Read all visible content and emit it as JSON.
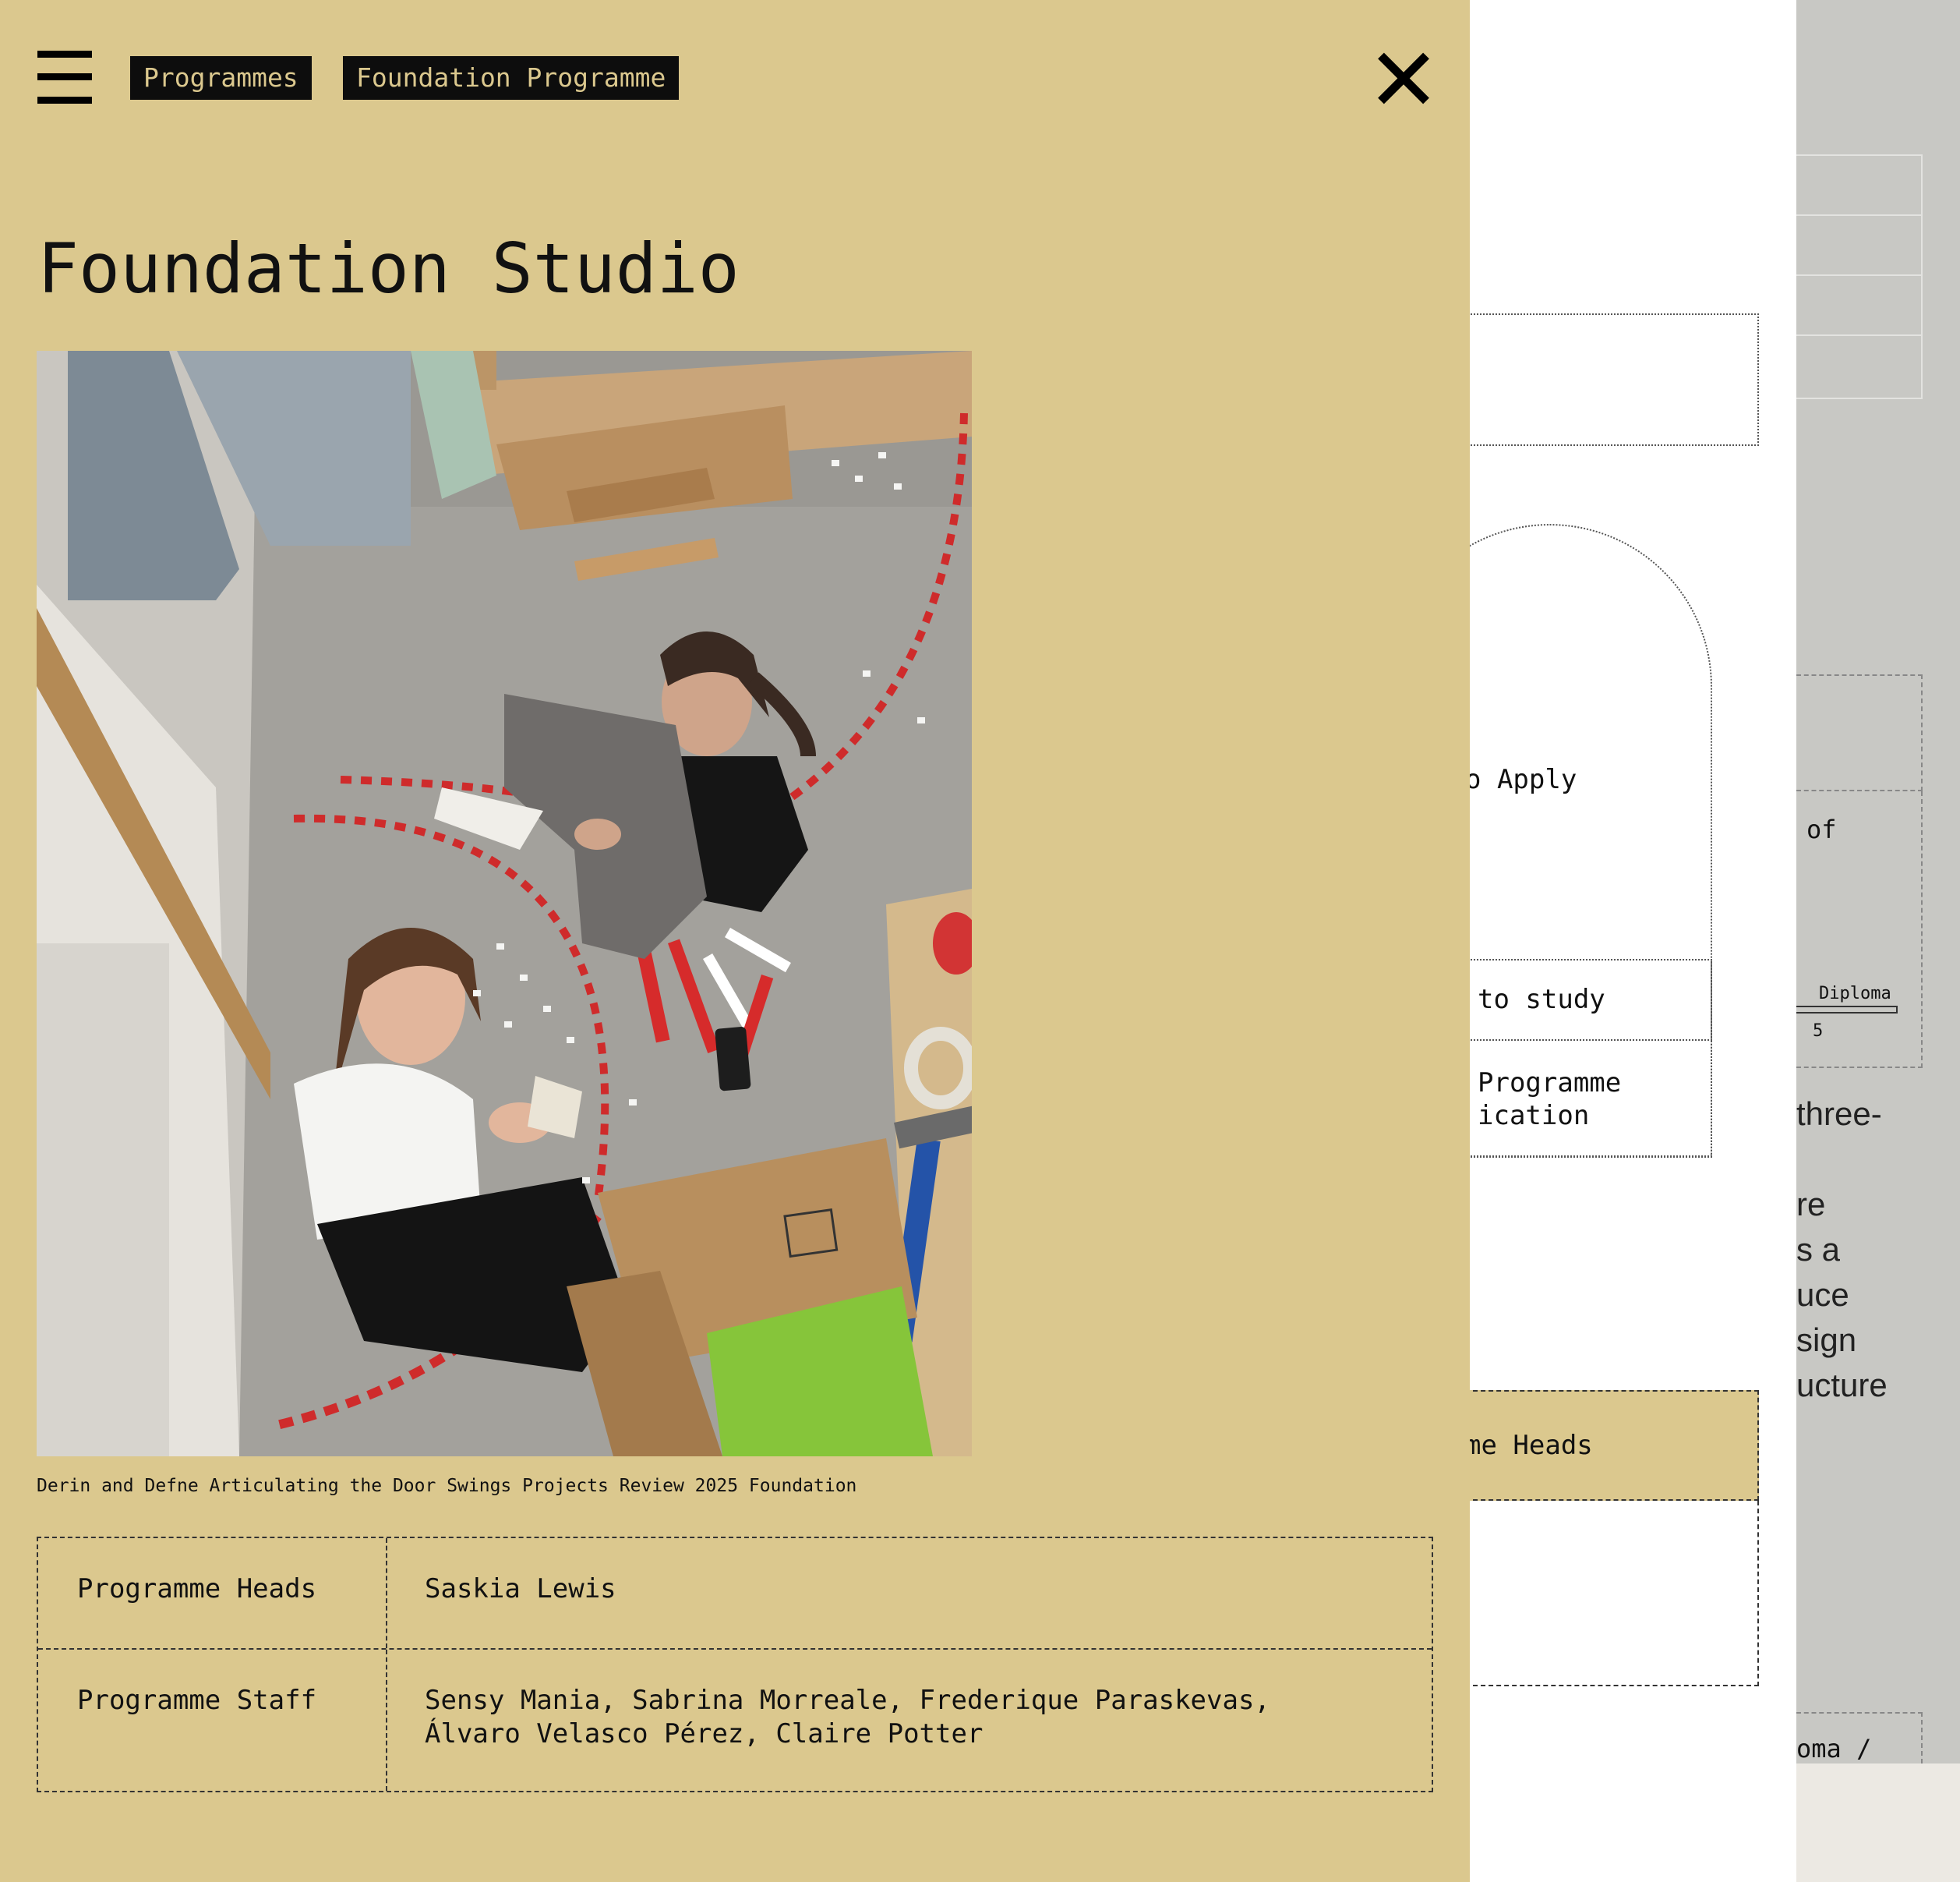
{
  "header": {
    "breadcrumbs": [
      "Programmes",
      "Foundation Programme"
    ]
  },
  "page": {
    "title": "Foundation Studio"
  },
  "photo": {
    "caption": "Derin and Defne Articulating the Door Swings Projects Review 2025 Foundation"
  },
  "info": {
    "rows": [
      {
        "label": "Programme Heads",
        "value": "Saskia Lewis"
      },
      {
        "label": "Programme Staff",
        "value_lines": [
          "Sensy Mania, Sabrina Morreale, Frederique Paraskevas,",
          "Álvaro Velasco Pérez, Claire Potter"
        ]
      }
    ]
  },
  "background": {
    "white_column": {
      "apply": "o Apply",
      "study": "to study",
      "programme_lines": [
        "Programme",
        "ication"
      ],
      "heads": "me Heads"
    },
    "grey_column": {
      "of": "of",
      "diploma": "Diploma",
      "five": "5",
      "text_lines": [
        "three-",
        "",
        "re",
        "s a",
        "uce",
        "sign",
        "ucture"
      ],
      "oma": "oma /"
    }
  },
  "colors": {
    "panel_bg": "#dbc88e",
    "crumb_bg": "#0d0d0d",
    "page_grey": "#c8c8c4"
  },
  "icons": {
    "menu": "hamburger-icon",
    "close": "close-icon"
  }
}
